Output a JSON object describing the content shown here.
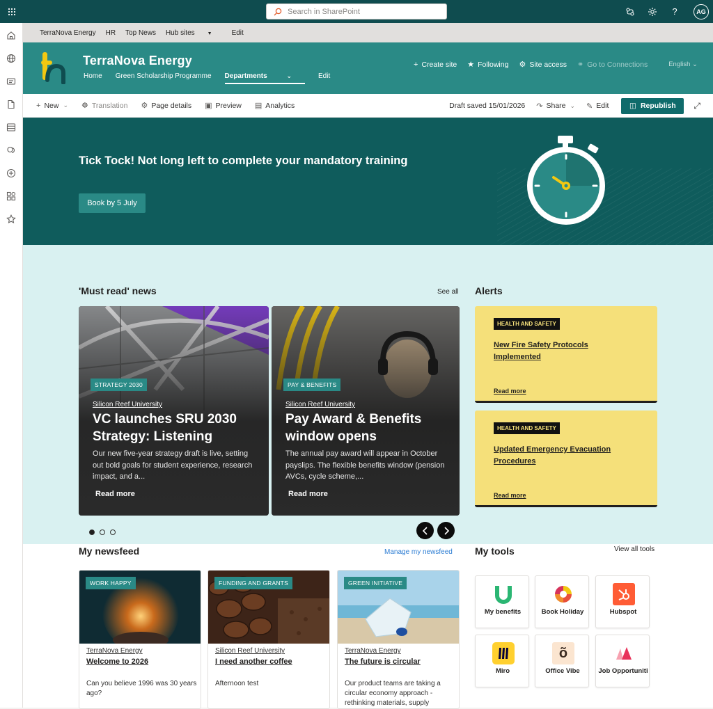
{
  "suite": {
    "search_placeholder": "Search in SharePoint",
    "avatar_initials": "AG"
  },
  "hubnav": {
    "items": [
      "TerraNova Energy",
      "HR",
      "Top News",
      "Hub sites",
      "Edit"
    ]
  },
  "site": {
    "title": "TerraNova Energy",
    "nav": [
      "Home",
      "Green Scholarship Programme",
      "Departments",
      "Edit"
    ],
    "actions": {
      "create_site": "Create site",
      "following": "Following",
      "site_access": "Site access",
      "go_to_connections": "Go to Connections",
      "language": "English"
    }
  },
  "commandbar": {
    "new": "New",
    "translation": "Translation",
    "page_details": "Page details",
    "preview": "Preview",
    "analytics": "Analytics",
    "draft_status": "Draft saved 15/01/2026",
    "share": "Share",
    "edit": "Edit",
    "republish": "Republish"
  },
  "hero": {
    "title": "Tick Tock! Not long left to complete your mandatory training",
    "button": "Book by 5 July"
  },
  "must_read": {
    "title": "'Must read' news",
    "see_all": "See all",
    "cards": [
      {
        "tag": "STRATEGY 2030",
        "source": "Silicon Reef University",
        "title": "VC launches SRU 2030 Strategy: Listening",
        "description": "Our new five-year strategy draft is live, setting out bold goals for student experience, research impact, and a...",
        "read_more": "Read more"
      },
      {
        "tag": "PAY & BENEFITS",
        "source": "Silicon Reef University",
        "title": "Pay Award & Benefits window opens",
        "description": "The annual pay award will appear in October payslips. The flexible benefits window (pension AVCs, cycle scheme,...",
        "read_more": "Read more"
      }
    ]
  },
  "alerts": {
    "title": "Alerts",
    "items": [
      {
        "badge": "HEALTH AND SAFETY",
        "title": "New Fire Safety Protocols Implemented",
        "read_more": "Read more"
      },
      {
        "badge": "HEALTH AND SAFETY",
        "title": "Updated Emergency Evacuation Procedures",
        "read_more": "Read more"
      }
    ]
  },
  "newsfeed": {
    "title": "My newsfeed",
    "manage": "Manage my newsfeed",
    "cards": [
      {
        "tag": "WORK HAPPY",
        "source": "TerraNova Energy",
        "title": "Welcome to 2026",
        "description": "Can you believe 1996 was 30 years ago?"
      },
      {
        "tag": "FUNDING AND GRANTS",
        "source": "Silicon Reef University",
        "title": "I need another coffee",
        "description": "Afternoon test"
      },
      {
        "tag": "GREEN INITIATIVE",
        "source": "TerraNova Energy",
        "title": "The future is circular",
        "description": "Our product teams are taking a circular economy approach - rethinking materials, supply"
      }
    ]
  },
  "tools": {
    "title": "My tools",
    "view_all": "View all tools",
    "items": [
      "My benefits",
      "Book Holiday",
      "Hubspot",
      "Miro",
      "Office Vibe",
      "Job Opportuniti"
    ]
  },
  "colors": {
    "suitebar": "#0f4c4f",
    "site_header": "#2a8a86",
    "hero": "#0f5c5c",
    "band": "#d9f1f1",
    "alert": "#f5e07a",
    "accent_yellow": "#f2c811"
  }
}
